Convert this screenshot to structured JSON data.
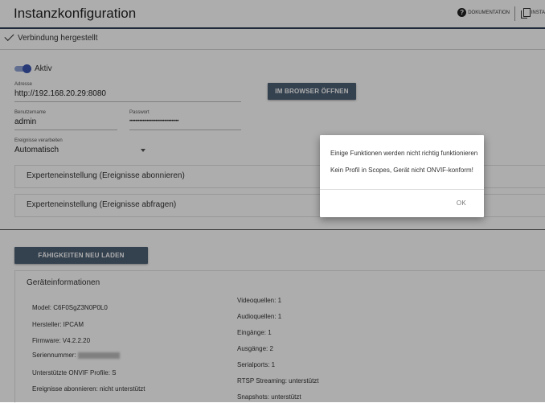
{
  "header": {
    "title": "Instanzkonfiguration",
    "doc_label": "DOKUMENTATION",
    "inst_label": "INSTA",
    "doc_icon": "help-circle-icon",
    "inst_icon": "copy-icon"
  },
  "status": {
    "text": "Verbindung hergestellt",
    "icon": "check-icon"
  },
  "form": {
    "active_label": "Aktiv",
    "active": true,
    "address": {
      "label": "Adresse",
      "value": "http://192.168.20.29:8080"
    },
    "open_browser_button": "IM BROWSER ÖFFNEN",
    "username": {
      "label": "Benutzername",
      "value": "admin"
    },
    "password": {
      "label": "Passwort",
      "value": "••••••••••••••••••••••••••••••••••"
    },
    "events": {
      "label": "Ereignisse verarbeiten",
      "value": "Automatisch"
    },
    "expert_subscribe": "Experteneinstellung (Ereignisse abonnieren)",
    "expert_query": "Experteneinstellung (Ereignisse abfragen)"
  },
  "reload_button": "FÄHIGKEITEN NEU LADEN",
  "device_info": {
    "title": "Geräteinformationen",
    "model": "Model: C6F0SgZ3N0P0L0",
    "manufacturer": "Hersteller: IPCAM",
    "firmware": "Firmware: V4.2.2.20",
    "serial": "Seriennummer:",
    "profiles": "Unterstützte ONVIF Profile: S",
    "events_subscribe": "Ereignisse abonnieren: nicht unterstützt",
    "video_sources": "Videoquellen: 1",
    "audio_sources": "Audioquellen: 1",
    "inputs": "Eingänge: 1",
    "outputs": "Ausgänge: 2",
    "serialports": "Serialports: 1",
    "rtsp": "RTSP Streaming: unterstützt",
    "snapshots": "Snapshots: unterstützt"
  },
  "dialog": {
    "line1": "Einige Funktionen werden nicht richtig funktionieren",
    "line2": "Kein Profil in Scopes, Gerät nicht ONVIF-konform!",
    "ok": "OK"
  },
  "colors": {
    "accent": "#3a55b0",
    "button": "#4d6175",
    "header_border": "#2f3f56"
  }
}
